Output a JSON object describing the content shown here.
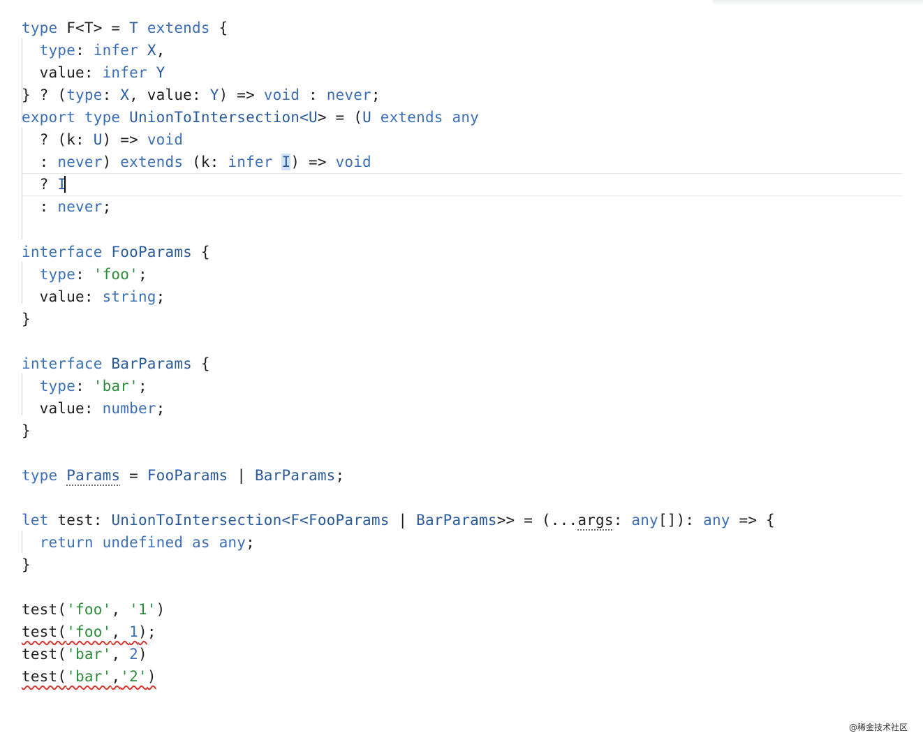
{
  "editor": {
    "lines": [
      [
        {
          "t": "type",
          "c": "kw"
        },
        {
          "t": " F<T> = ",
          "c": "p"
        },
        {
          "t": "T",
          "c": "ty"
        },
        {
          "t": " ",
          "c": "p"
        },
        {
          "t": "extends",
          "c": "kw"
        },
        {
          "t": " {",
          "c": "p"
        }
      ],
      [
        {
          "t": "  ",
          "c": "p"
        },
        {
          "t": "type",
          "c": "kw"
        },
        {
          "t": ": ",
          "c": "p"
        },
        {
          "t": "infer",
          "c": "kw"
        },
        {
          "t": " ",
          "c": "p"
        },
        {
          "t": "X",
          "c": "ty"
        },
        {
          "t": ",",
          "c": "p"
        }
      ],
      [
        {
          "t": "  value: ",
          "c": "p"
        },
        {
          "t": "infer",
          "c": "kw"
        },
        {
          "t": " ",
          "c": "p"
        },
        {
          "t": "Y",
          "c": "ty"
        }
      ],
      [
        {
          "t": "} ? (",
          "c": "p"
        },
        {
          "t": "type",
          "c": "kw"
        },
        {
          "t": ": ",
          "c": "p"
        },
        {
          "t": "X",
          "c": "ty"
        },
        {
          "t": ", value: ",
          "c": "p"
        },
        {
          "t": "Y",
          "c": "ty"
        },
        {
          "t": ") => ",
          "c": "p"
        },
        {
          "t": "void",
          "c": "kw"
        },
        {
          "t": " : ",
          "c": "p"
        },
        {
          "t": "never",
          "c": "kw"
        },
        {
          "t": ";",
          "c": "p"
        }
      ],
      [
        {
          "t": "export type",
          "c": "kw"
        },
        {
          "t": " UnionToIntersection<",
          "c": "ty"
        },
        {
          "t": "U",
          "c": "ty"
        },
        {
          "t": "> = (",
          "c": "p"
        },
        {
          "t": "U",
          "c": "ty"
        },
        {
          "t": " ",
          "c": "p"
        },
        {
          "t": "extends",
          "c": "kw"
        },
        {
          "t": " ",
          "c": "p"
        },
        {
          "t": "any",
          "c": "kw"
        }
      ],
      [
        {
          "t": "  ? (k: ",
          "c": "p"
        },
        {
          "t": "U",
          "c": "ty"
        },
        {
          "t": ") => ",
          "c": "p"
        },
        {
          "t": "void",
          "c": "kw"
        }
      ],
      [
        {
          "t": "  : ",
          "c": "p"
        },
        {
          "t": "never",
          "c": "kw"
        },
        {
          "t": ") ",
          "c": "p"
        },
        {
          "t": "extends",
          "c": "kw"
        },
        {
          "t": " (k: ",
          "c": "p"
        },
        {
          "t": "infer",
          "c": "kw"
        },
        {
          "t": " ",
          "c": "p"
        },
        {
          "t": "I",
          "c": "ty",
          "hl": true
        },
        {
          "t": ") => ",
          "c": "p"
        },
        {
          "t": "void",
          "c": "kw"
        }
      ],
      [
        {
          "t": "  ? ",
          "c": "p"
        },
        {
          "t": "I",
          "c": "ty"
        }
      ],
      [
        {
          "t": "  : ",
          "c": "p"
        },
        {
          "t": "never",
          "c": "kw"
        },
        {
          "t": ";",
          "c": "p"
        }
      ],
      [],
      [
        {
          "t": "interface",
          "c": "kw"
        },
        {
          "t": " FooParams",
          "c": "ty"
        },
        {
          "t": " {",
          "c": "p"
        }
      ],
      [
        {
          "t": "  ",
          "c": "p"
        },
        {
          "t": "type",
          "c": "kw"
        },
        {
          "t": ": ",
          "c": "p"
        },
        {
          "t": "'foo'",
          "c": "str"
        },
        {
          "t": ";",
          "c": "p"
        }
      ],
      [
        {
          "t": "  value: ",
          "c": "p"
        },
        {
          "t": "string",
          "c": "kw"
        },
        {
          "t": ";",
          "c": "p"
        }
      ],
      [
        {
          "t": "}",
          "c": "p"
        }
      ],
      [],
      [
        {
          "t": "interface",
          "c": "kw"
        },
        {
          "t": " BarParams",
          "c": "ty"
        },
        {
          "t": " {",
          "c": "p"
        }
      ],
      [
        {
          "t": "  ",
          "c": "p"
        },
        {
          "t": "type",
          "c": "kw"
        },
        {
          "t": ": ",
          "c": "p"
        },
        {
          "t": "'bar'",
          "c": "str"
        },
        {
          "t": ";",
          "c": "p"
        }
      ],
      [
        {
          "t": "  value: ",
          "c": "p"
        },
        {
          "t": "number",
          "c": "kw"
        },
        {
          "t": ";",
          "c": "p"
        }
      ],
      [
        {
          "t": "}",
          "c": "p"
        }
      ],
      [],
      [
        {
          "t": "type",
          "c": "kw"
        },
        {
          "t": " ",
          "c": "p"
        },
        {
          "t": "Params",
          "c": "ty",
          "dots": true
        },
        {
          "t": " = ",
          "c": "p"
        },
        {
          "t": "FooParams",
          "c": "ty"
        },
        {
          "t": " | ",
          "c": "p"
        },
        {
          "t": "BarParams",
          "c": "ty"
        },
        {
          "t": ";",
          "c": "p"
        }
      ],
      [],
      [
        {
          "t": "let",
          "c": "kw"
        },
        {
          "t": " test: ",
          "c": "p"
        },
        {
          "t": "UnionToIntersection<",
          "c": "ty"
        },
        {
          "t": "F<",
          "c": "ty"
        },
        {
          "t": "FooParams",
          "c": "ty"
        },
        {
          "t": " | ",
          "c": "p"
        },
        {
          "t": "BarParams",
          "c": "ty"
        },
        {
          "t": ">> = (...",
          "c": "p"
        },
        {
          "t": "args",
          "c": "p",
          "dots": true
        },
        {
          "t": ": ",
          "c": "p"
        },
        {
          "t": "any",
          "c": "kw"
        },
        {
          "t": "[]): ",
          "c": "p"
        },
        {
          "t": "any",
          "c": "kw"
        },
        {
          "t": " => {",
          "c": "p"
        }
      ],
      [
        {
          "t": "  ",
          "c": "p"
        },
        {
          "t": "return",
          "c": "kw"
        },
        {
          "t": " ",
          "c": "p"
        },
        {
          "t": "undefined",
          "c": "kw"
        },
        {
          "t": " ",
          "c": "p"
        },
        {
          "t": "as",
          "c": "kw"
        },
        {
          "t": " ",
          "c": "p"
        },
        {
          "t": "any",
          "c": "kw"
        },
        {
          "t": ";",
          "c": "p"
        }
      ],
      [
        {
          "t": "}",
          "c": "p"
        }
      ],
      [],
      [
        {
          "t": "test(",
          "c": "p"
        },
        {
          "t": "'foo'",
          "c": "str"
        },
        {
          "t": ", ",
          "c": "p"
        },
        {
          "t": "'1'",
          "c": "str"
        },
        {
          "t": ")",
          "c": "p"
        }
      ],
      [
        {
          "t": "test(",
          "c": "p",
          "err": true
        },
        {
          "t": "'foo'",
          "c": "str",
          "err": true
        },
        {
          "t": ", ",
          "c": "p",
          "err": true
        },
        {
          "t": "1",
          "c": "num",
          "err": true
        },
        {
          "t": ")",
          "c": "p",
          "err": true
        },
        {
          "t": ";",
          "c": "p"
        }
      ],
      [
        {
          "t": "test(",
          "c": "p"
        },
        {
          "t": "'bar'",
          "c": "str"
        },
        {
          "t": ", ",
          "c": "p"
        },
        {
          "t": "2",
          "c": "num"
        },
        {
          "t": ")",
          "c": "p"
        }
      ],
      [
        {
          "t": "test(",
          "c": "p",
          "err": true
        },
        {
          "t": "'bar'",
          "c": "str",
          "err": true
        },
        {
          "t": ",",
          "c": "p",
          "err": true
        },
        {
          "t": "'2'",
          "c": "str",
          "err": true
        },
        {
          "t": ")",
          "c": "p",
          "err": true
        }
      ]
    ],
    "cursor_line": 8
  },
  "watermark": "@稀金技术社区",
  "colors": {
    "keyword": "#3c6fb8",
    "string": "#2e8b3a",
    "type": "#2a5a9c",
    "plain": "#1e1e1e",
    "error_squiggle": "#d9332e"
  }
}
